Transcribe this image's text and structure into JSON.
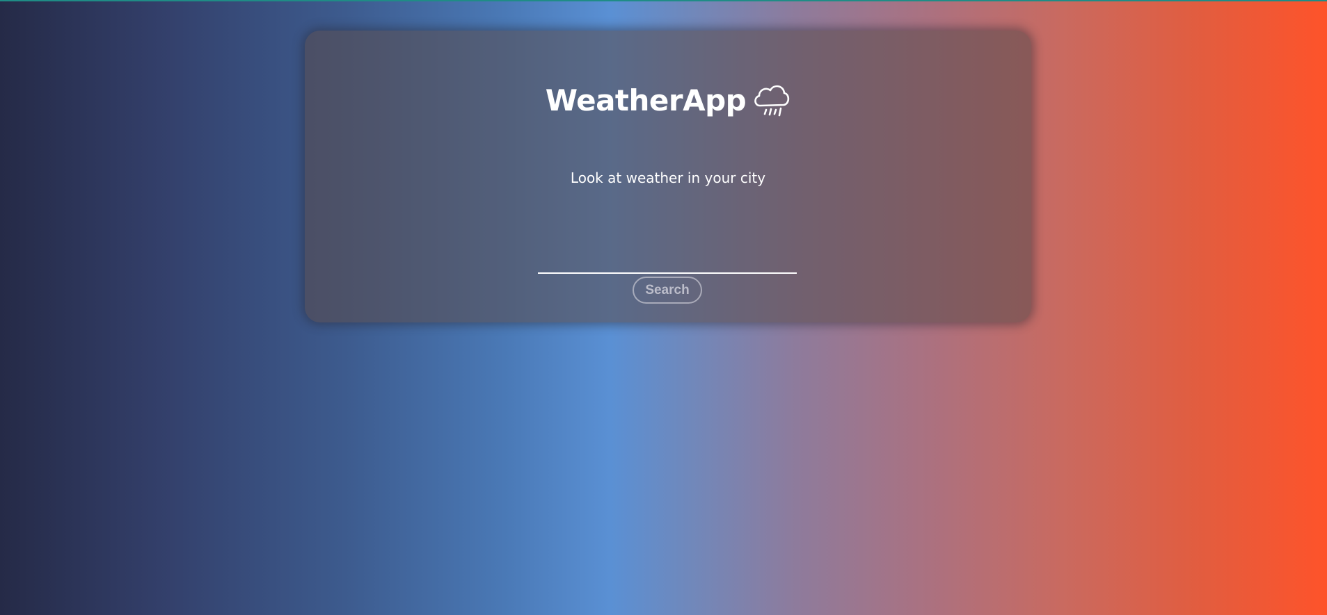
{
  "header": {
    "title": "WeatherApp",
    "icon": "cloud-rain-icon"
  },
  "main": {
    "subtitle": "Look at weather in your city",
    "search_input": {
      "value": "",
      "placeholder": ""
    },
    "search_button_label": "Search"
  },
  "colors": {
    "gradient_start": "#252a47",
    "gradient_mid": "#5a90d4",
    "gradient_end": "#fe532a",
    "text": "#ffffff"
  }
}
